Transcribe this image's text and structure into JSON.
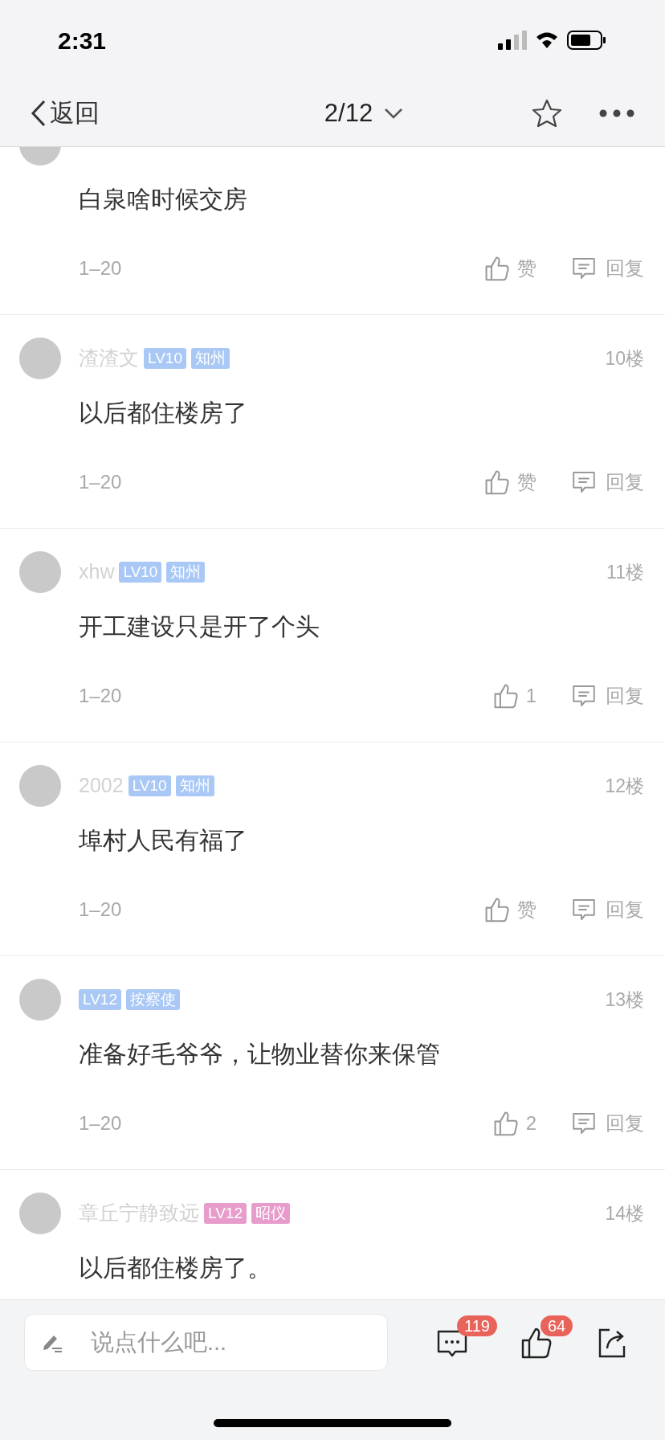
{
  "status_bar": {
    "time": "2:31"
  },
  "nav": {
    "back": "返回",
    "page": "2/12"
  },
  "posts": [
    {
      "text": "白泉啥时候交房",
      "time": "1–20",
      "like": "赞",
      "reply": "回复"
    },
    {
      "name": "渣渣文",
      "badges": [
        {
          "label": "LV10",
          "color": "#a9c8f6"
        },
        {
          "label": "知州",
          "color": "#a9c8f6"
        }
      ],
      "floor": "10楼",
      "text": "以后都住楼房了",
      "time": "1–20",
      "like": "赞",
      "reply": "回复"
    },
    {
      "name": "xhw",
      "badges": [
        {
          "label": "LV10",
          "color": "#a9c8f6"
        },
        {
          "label": "知州",
          "color": "#a9c8f6"
        }
      ],
      "floor": "11楼",
      "text": "开工建设只是开了个头",
      "time": "1–20",
      "like": "1",
      "reply": "回复"
    },
    {
      "name": "2002",
      "badges": [
        {
          "label": "LV10",
          "color": "#a9c8f6"
        },
        {
          "label": "知州",
          "color": "#a9c8f6"
        }
      ],
      "floor": "12楼",
      "text": "埠村人民有福了",
      "time": "1–20",
      "like": "赞",
      "reply": "回复"
    },
    {
      "badges": [
        {
          "label": "LV12",
          "color": "#a9c8f6"
        },
        {
          "label": "按察使",
          "color": "#a9c8f6"
        }
      ],
      "floor": "13楼",
      "text": "准备好毛爷爷，让物业替你来保管",
      "time": "1–20",
      "like": "2",
      "reply": "回复"
    },
    {
      "name": "章丘宁静致远",
      "badges": [
        {
          "label": "LV12",
          "color": "#e79ccb"
        },
        {
          "label": "昭仪",
          "color": "#e79ccb"
        }
      ],
      "floor": "14楼",
      "text": "以后都住楼房了。"
    }
  ],
  "bottom_bar": {
    "placeholder": "说点什么吧...",
    "comment_count": "119",
    "like_count": "64"
  }
}
